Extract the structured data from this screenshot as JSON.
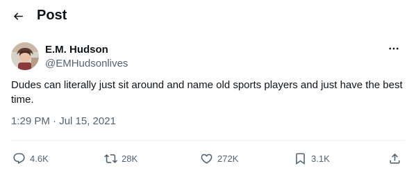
{
  "header": {
    "title": "Post",
    "back_icon": "arrow-left-icon"
  },
  "author": {
    "name": "E.M. Hudson",
    "handle": "@EMHudsonlives",
    "avatar_icon": "avatar-photo"
  },
  "post": {
    "text": "Dudes can literally just sit around and name old sports players and just have the best time.",
    "timestamp": "1:29 PM · Jul 15, 2021"
  },
  "actions": {
    "replies": "4.6K",
    "reposts": "28K",
    "likes": "272K",
    "bookmarks": "3.1K"
  },
  "icons": {
    "reply": "speech-bubble-icon",
    "repost": "retweet-icon",
    "like": "heart-icon",
    "bookmark": "bookmark-icon",
    "share": "share-icon",
    "more": "more-dots-icon"
  },
  "colors": {
    "text": "#0f1419",
    "secondary": "#536471",
    "divider": "#eff3f4"
  }
}
